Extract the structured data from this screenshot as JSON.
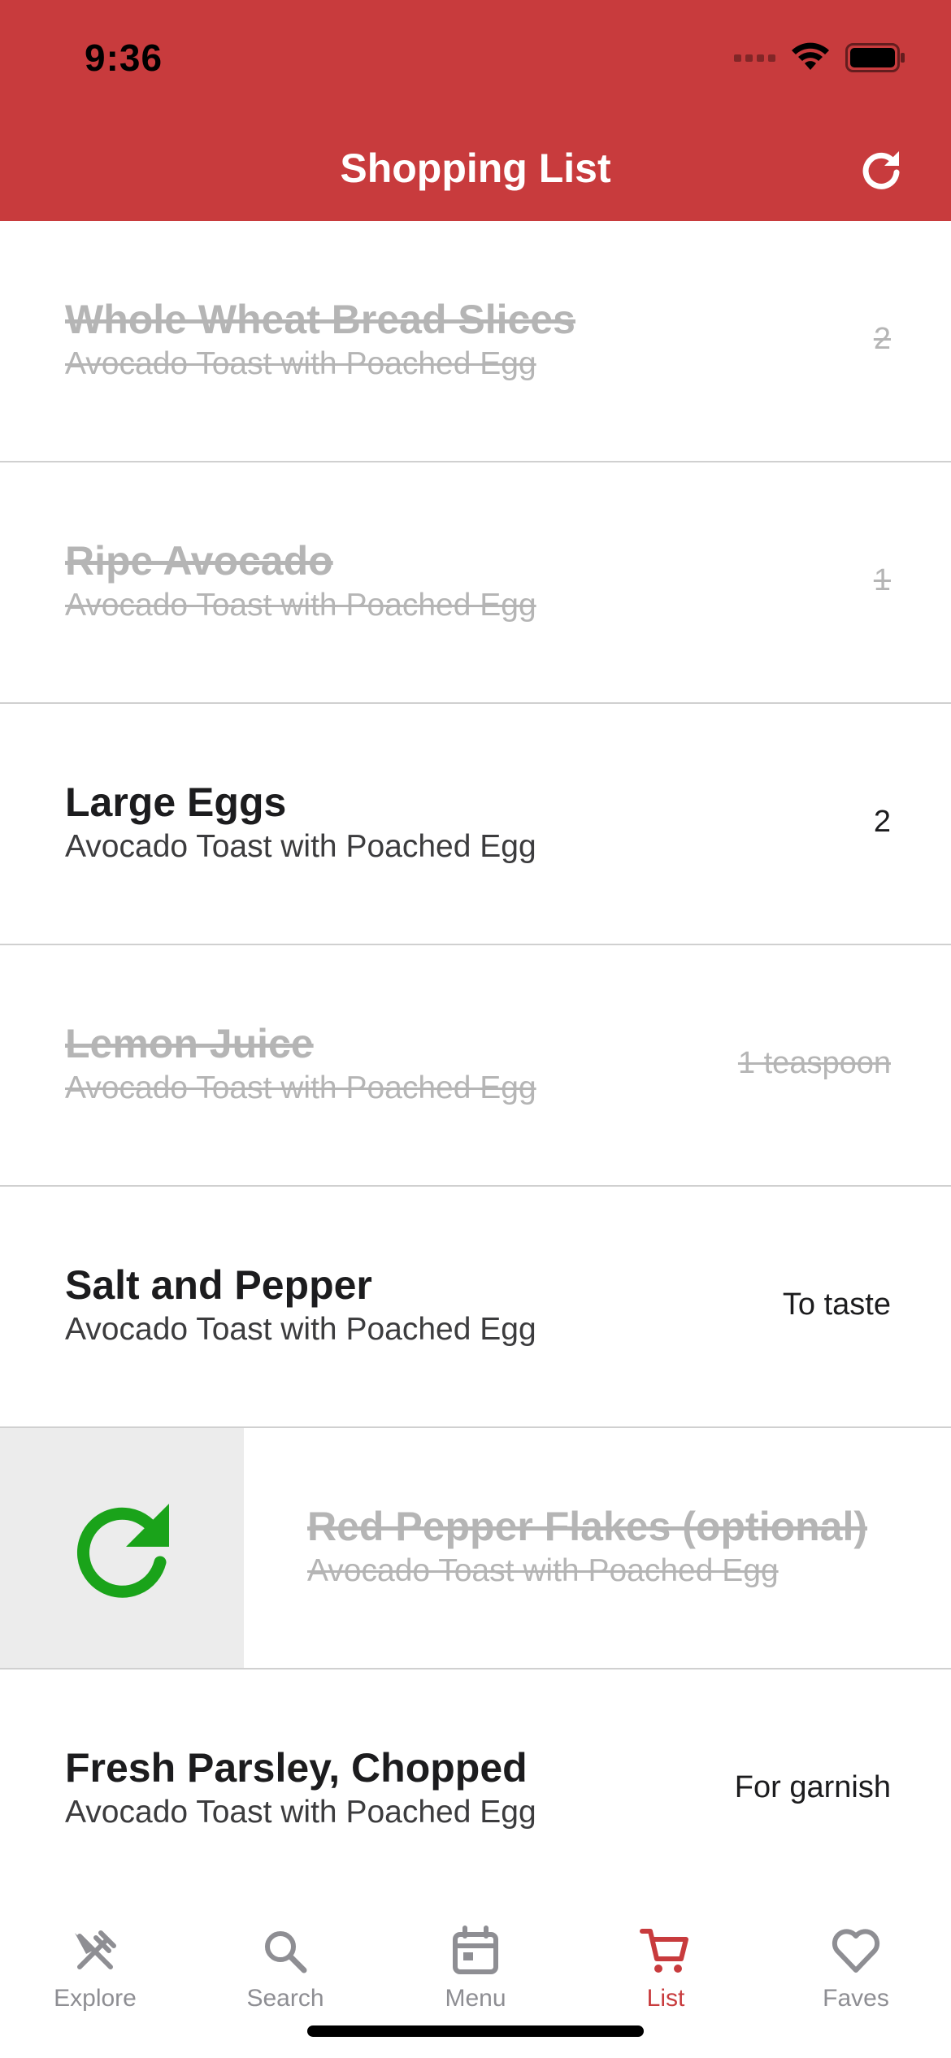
{
  "status_bar": {
    "time": "9:36"
  },
  "header": {
    "title": "Shopping List",
    "refresh_icon": "refresh-icon",
    "background": "#c83b3d"
  },
  "items": [
    {
      "name": "Whole Wheat Bread Slices",
      "recipe": "Avocado Toast with Poached Egg",
      "quantity": "2",
      "checked": true
    },
    {
      "name": "Ripe Avocado",
      "recipe": "Avocado Toast with Poached Egg",
      "quantity": "1",
      "checked": true
    },
    {
      "name": "Large Eggs",
      "recipe": "Avocado Toast with Poached Egg",
      "quantity": "2",
      "checked": false
    },
    {
      "name": "Lemon Juice",
      "recipe": "Avocado Toast with Poached Egg",
      "quantity": "1 teaspoon",
      "checked": true
    },
    {
      "name": "Salt and Pepper",
      "recipe": "Avocado Toast with Poached Egg",
      "quantity": "To taste",
      "checked": false
    },
    {
      "name": "Red Pepper Flakes (optional)",
      "recipe": "Avocado Toast with Poached Egg",
      "checked": true,
      "swipe_action_icon": "restore-icon",
      "swipe_action_color": "#1aa31a"
    },
    {
      "name": "Fresh Parsley, Chopped",
      "recipe": "Avocado Toast with Poached Egg",
      "quantity": "For garnish",
      "checked": false
    }
  ],
  "tabs": [
    {
      "label": "Explore",
      "icon": "fork-knife-icon",
      "active": false
    },
    {
      "label": "Search",
      "icon": "search-icon",
      "active": false
    },
    {
      "label": "Menu",
      "icon": "calendar-icon",
      "active": false
    },
    {
      "label": "List",
      "icon": "cart-icon",
      "active": true
    },
    {
      "label": "Faves",
      "icon": "heart-icon",
      "active": false
    }
  ],
  "colors": {
    "accent": "#c83b3d",
    "checked_text": "#b5b5b5",
    "inactive_tab": "#8e8e93"
  }
}
